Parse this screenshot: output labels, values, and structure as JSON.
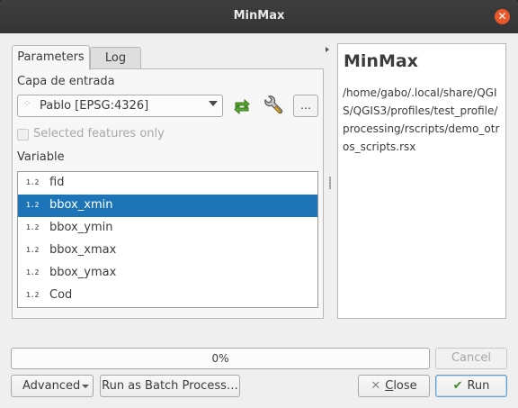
{
  "window": {
    "title": "MinMax",
    "close_symbol": "✕"
  },
  "tabs": [
    {
      "label": "Parameters",
      "active": true
    },
    {
      "label": "Log",
      "active": false
    }
  ],
  "parameters": {
    "layer_label": "Capa de entrada",
    "layer_value": "Pablo [EPSG:4326]",
    "layer_icon": "point-layer-icon",
    "selected_only_label": "Selected features only",
    "selected_only_checked": false,
    "more_button": "…",
    "variable_label": "Variable",
    "variables": [
      {
        "type": "1.2",
        "name": "fid",
        "selected": false
      },
      {
        "type": "1.2",
        "name": "bbox_xmin",
        "selected": true
      },
      {
        "type": "1.2",
        "name": "bbox_ymin",
        "selected": false
      },
      {
        "type": "1.2",
        "name": "bbox_xmax",
        "selected": false
      },
      {
        "type": "1.2",
        "name": "bbox_ymax",
        "selected": false
      },
      {
        "type": "1.2",
        "name": "Cod",
        "selected": false
      }
    ]
  },
  "help": {
    "title": "MinMax",
    "path": "/home/gabo/.local/share/QGIS/QGIS3/profiles/test_profile/processing/rscripts/demo_otros_scripts.rsx"
  },
  "progress": {
    "value": 0,
    "text": "0%"
  },
  "buttons": {
    "cancel": "Cancel",
    "advanced": "Advanced",
    "batch": "Run as Batch Process…",
    "close": "Close",
    "close_mnemonic": "C",
    "close_rest": "lose",
    "run": "Run"
  },
  "colors": {
    "selection": "#1d75b8",
    "titlebar": "#383838",
    "close_button": "#e9582b"
  }
}
